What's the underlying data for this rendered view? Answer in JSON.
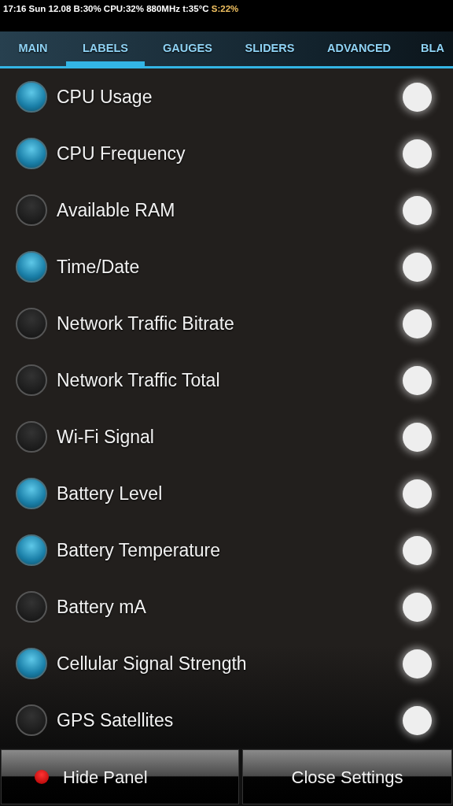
{
  "status_bar": {
    "text": "17:16 Sun 12.08 B:30% CPU:32% 880MHz t:35°C",
    "highlight": "S:22%"
  },
  "tabs": [
    {
      "label": "MAIN",
      "selected": false
    },
    {
      "label": "LABELS",
      "selected": true
    },
    {
      "label": "GAUGES",
      "selected": false
    },
    {
      "label": "SLIDERS",
      "selected": false
    },
    {
      "label": "ADVANCED",
      "selected": false
    },
    {
      "label": "BLA",
      "selected": false
    }
  ],
  "items": [
    {
      "label": "CPU Usage",
      "checked": true,
      "color": "#eeeeee"
    },
    {
      "label": "CPU Frequency",
      "checked": true,
      "color": "#eeeeee"
    },
    {
      "label": "Available RAM",
      "checked": false,
      "color": "#eeeeee"
    },
    {
      "label": "Time/Date",
      "checked": true,
      "color": "#eeeeee"
    },
    {
      "label": "Network Traffic Bitrate",
      "checked": false,
      "color": "#eeeeee"
    },
    {
      "label": "Network Traffic Total",
      "checked": false,
      "color": "#eeeeee"
    },
    {
      "label": "Wi-Fi Signal",
      "checked": false,
      "color": "#eeeeee"
    },
    {
      "label": "Battery Level",
      "checked": true,
      "color": "#eeeeee"
    },
    {
      "label": "Battery Temperature",
      "checked": true,
      "color": "#eeeeee"
    },
    {
      "label": "Battery mA",
      "checked": false,
      "color": "#eeeeee"
    },
    {
      "label": "Cellular Signal Strength",
      "checked": true,
      "color": "#eeeeee"
    },
    {
      "label": "GPS Satellites",
      "checked": false,
      "color": "#eeeeee"
    }
  ],
  "buttons": [
    {
      "label": "Hide Panel",
      "kind": "indicator"
    },
    {
      "label": "Close Settings",
      "kind": "plain"
    }
  ]
}
